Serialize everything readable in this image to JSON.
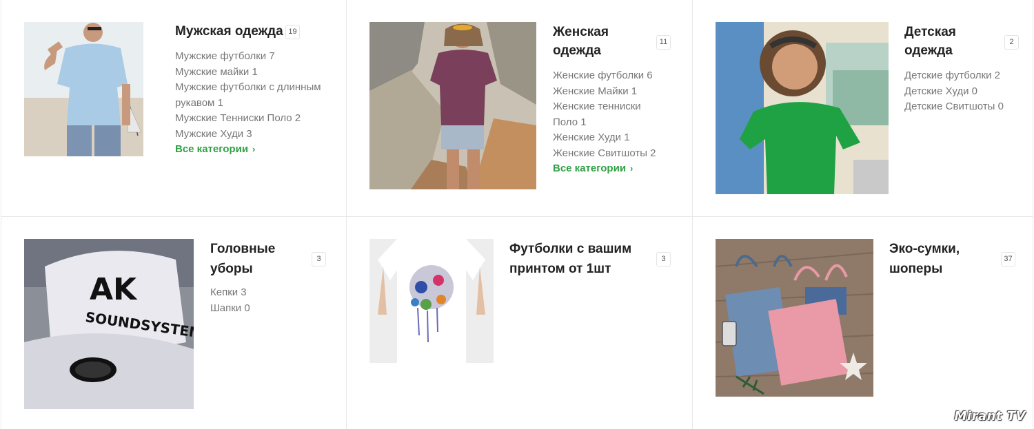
{
  "categories": [
    {
      "title": "Мужская одежда",
      "count": "19",
      "items": [
        "Мужские футболки 7",
        "Мужские майки 1",
        "Мужские футболки с длинным рукавом 1",
        "Мужские Тенниски Поло 2",
        "Мужские Худи 3"
      ],
      "all_link": "Все категории"
    },
    {
      "title": "Женская одежда",
      "count": "11",
      "items": [
        "Женские футболки 6",
        "Женские Майки 1",
        "Женские тенниски Поло 1",
        "Женские Худи 1",
        "Женские Свитшоты 2"
      ],
      "all_link": "Все категории"
    },
    {
      "title": "Детская одежда",
      "count": "2",
      "items": [
        "Детские футболки 2",
        "Детские Худи 0",
        "Детские Свитшоты 0"
      ]
    },
    {
      "title": "Головные уборы",
      "count": "3",
      "items": [
        "Кепки 3",
        "Шапки 0"
      ],
      "image_text": [
        "AK",
        "SOUNDSYSTEM"
      ]
    },
    {
      "title": "Футболки с вашим принтом от 1шт",
      "count": "3",
      "items": []
    },
    {
      "title": "Эко-сумки, шоперы",
      "count": "37",
      "items": []
    }
  ],
  "watermark": "Mirant TV",
  "colors": {
    "link_green": "#2fa043",
    "border": "#e8e8e8",
    "text_muted": "#777777",
    "title": "#222222"
  }
}
